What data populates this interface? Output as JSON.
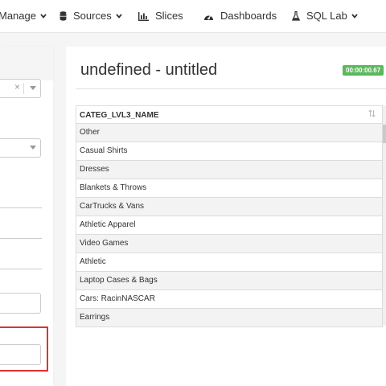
{
  "navbar": {
    "items": [
      {
        "label": "Manage",
        "icon": "none",
        "dropdown": true
      },
      {
        "label": "Sources",
        "icon": "database-icon",
        "dropdown": true
      },
      {
        "label": "Slices",
        "icon": "bar-chart-icon",
        "dropdown": false
      },
      {
        "label": "Dashboards",
        "icon": "dashboard-gauge-icon",
        "dropdown": false
      },
      {
        "label": "SQL Lab",
        "icon": "flask-icon",
        "dropdown": true
      }
    ]
  },
  "left_panel": {
    "clear_symbol": "×"
  },
  "results": {
    "title": "undefined - untitled",
    "timer": "00:00:00.67",
    "timer_color": "#5cb85c",
    "column_header": "CATEG_LVL3_NAME",
    "rows": [
      "Other",
      "Casual Shirts",
      "Dresses",
      "Blankets & Throws",
      "CarTrucks & Vans",
      "Athletic Apparel",
      "Video Games",
      "Athletic",
      "Laptop Cases & Bags",
      "Cars: RacinNASCAR",
      "Earrings"
    ]
  },
  "highlight_color": "#e0312a"
}
